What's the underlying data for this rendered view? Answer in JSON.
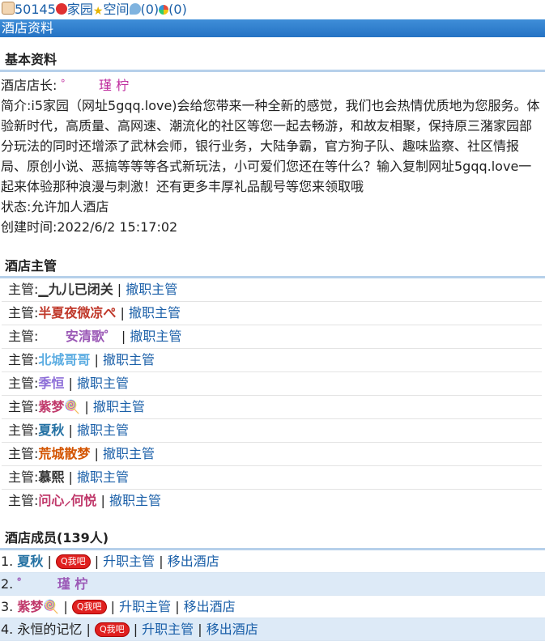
{
  "topbar": {
    "user_id": "50145",
    "home": "家园",
    "space": "空间",
    "chat_count": "(0)",
    "ring_count": "(0)"
  },
  "page_title": "酒店资料",
  "basic": {
    "heading": "基本资料",
    "owner_label": "酒店店长:",
    "owner_name": "゜      瑾 柠",
    "intro": "简介:i5家园（网址5gqq.love)会给您带来一种全新的感觉，我们也会热情优质地为您服务。体验新时代，高质量、高网速、潮流化的社区等您一起去畅游，和故友相聚，保持原三潴家园部分玩法的同时还增添了武林会师，银行业务，大陆争霸，官方狗子队、趣味监察、社区情报局、原创小说、恶搞等等等各式新玩法，小可爱们您还在等什么？输入复制网址5gqq.love一起来体验那种浪漫与刺激！还有更多丰厚礼品靓号等您来领取哦",
    "status": "状态:允许加人酒店",
    "created": "创建时间:2022/6/2 15:17:02"
  },
  "managers": {
    "heading": "酒店主管",
    "label": "主管:",
    "action": "撤职主管",
    "items": [
      {
        "name": "▁九儿已闭关",
        "color": "#333333"
      },
      {
        "name": "半夏夜微凉ぺ",
        "color": "#c0392b"
      },
      {
        "name": "      安清歌゜",
        "color": "#9b59b6"
      },
      {
        "name": "北城哥哥",
        "color": "#5dade2"
      },
      {
        "name": "季恒",
        "color": "#8e6fd8"
      },
      {
        "name": "紫梦🍭",
        "color": "#c0396b"
      },
      {
        "name": "夏秋",
        "color": "#2471a3"
      },
      {
        "name": "荒城散梦",
        "color": "#d35400"
      },
      {
        "name": "慕熙",
        "color": "#333333"
      },
      {
        "name": "问心⸝何悦",
        "color": "#c0396b"
      }
    ]
  },
  "members": {
    "heading": "酒店成员(139人)",
    "qq_label": "Q我吧",
    "promote": "升职主管",
    "remove": "移出酒店",
    "items": [
      {
        "num": "1.",
        "name": "夏秋",
        "color": "#2471a3",
        "qq": true
      },
      {
        "num": "2.",
        "name": "゜      瑾 柠",
        "color": "#9b59b6",
        "qq": false
      },
      {
        "num": "3.",
        "name": "紫梦🍭",
        "color": "#c0396b",
        "qq": true
      },
      {
        "num": "4.",
        "name": "永恒的记忆",
        "color": "#222222",
        "qq": true
      }
    ]
  }
}
